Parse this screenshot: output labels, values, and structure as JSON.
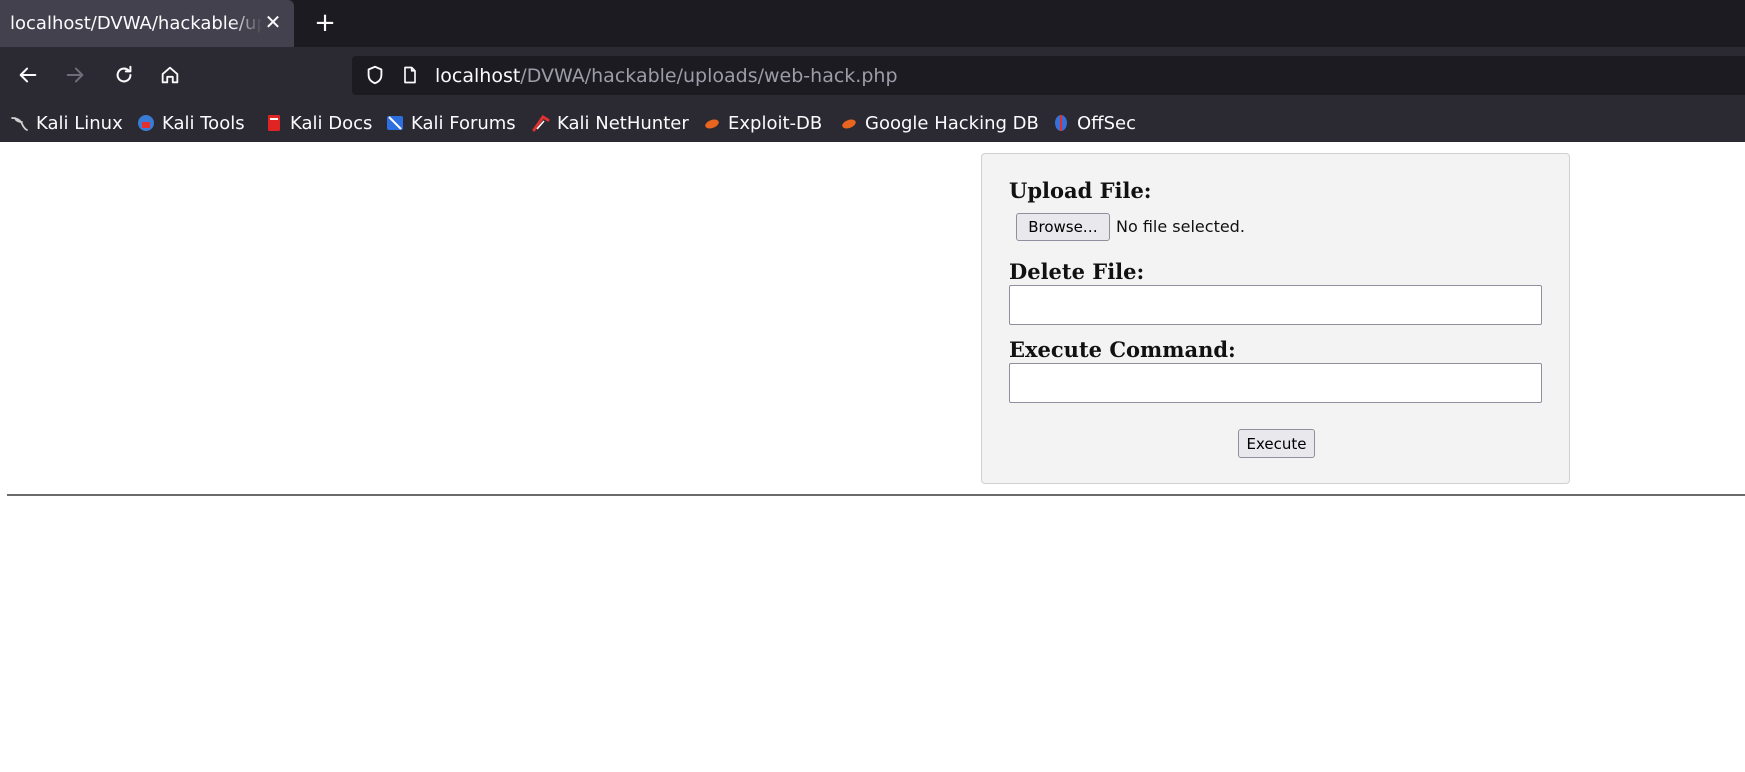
{
  "browser": {
    "tab": {
      "title": "localhost/DVWA/hackable/uploads/web-hack.php",
      "close_glyph": "✕"
    },
    "new_tab_glyph": "+",
    "url": {
      "host": "localhost",
      "path": "/DVWA/hackable/uploads/web-hack.php"
    },
    "nav_icons": [
      "back-icon",
      "forward-icon",
      "reload-icon",
      "home-icon"
    ],
    "bookmarks": [
      {
        "label": "Kali Linux",
        "icon": "kali-dragon-icon",
        "color": "#bbbbbb"
      },
      {
        "label": "Kali Tools",
        "icon": "kali-tools-icon",
        "color": "#3a7bd5"
      },
      {
        "label": "Kali Docs",
        "icon": "kali-docs-icon",
        "color": "#e02424"
      },
      {
        "label": "Kali Forums",
        "icon": "kali-forums-icon",
        "color": "#2d6fe0"
      },
      {
        "label": "Kali NetHunter",
        "icon": "kali-nethunter-icon",
        "color": "#e03030"
      },
      {
        "label": "Exploit-DB",
        "icon": "exploit-db-icon",
        "color": "#e8641f"
      },
      {
        "label": "Google Hacking DB",
        "icon": "ghdb-icon",
        "color": "#e8641f"
      },
      {
        "label": "OffSec",
        "icon": "offsec-icon",
        "color": "#3a6fd8"
      }
    ]
  },
  "form": {
    "upload_label": "Upload File:",
    "browse_label": "Browse…",
    "no_file_text": "No file selected.",
    "delete_label": "Delete File:",
    "delete_value": "",
    "execute_command_label": "Execute Command:",
    "command_value": "",
    "execute_button": "Execute"
  }
}
